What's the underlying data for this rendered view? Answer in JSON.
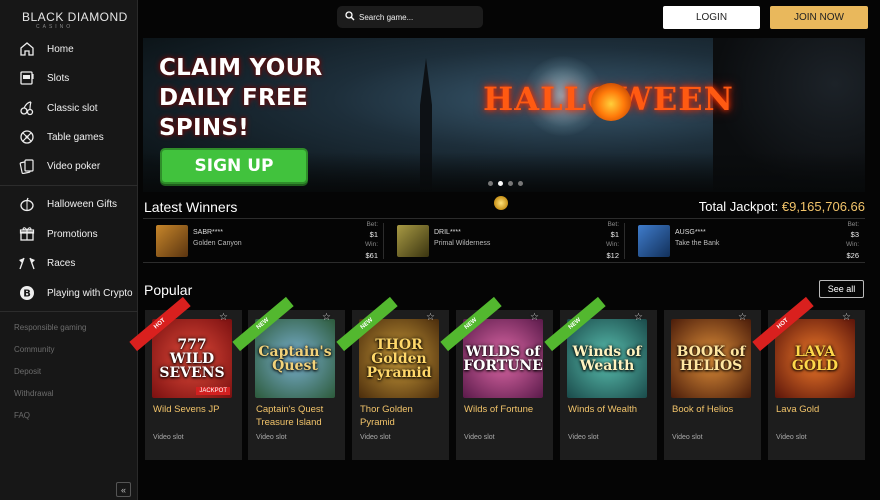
{
  "brand": {
    "logo": "BLACK DIAMOND",
    "logo_sub": "CASINO"
  },
  "search": {
    "placeholder": "Search game..."
  },
  "header": {
    "login": "LOGIN",
    "join": "JOIN NOW"
  },
  "sidebar": {
    "primary": [
      {
        "label": "Home",
        "icon": "home-icon"
      },
      {
        "label": "Slots",
        "icon": "slot-machine-icon"
      },
      {
        "label": "Classic slot",
        "icon": "cherry-icon"
      },
      {
        "label": "Table games",
        "icon": "roulette-icon"
      },
      {
        "label": "Video poker",
        "icon": "cards-icon"
      }
    ],
    "secondary": [
      {
        "label": "Halloween Gifts",
        "icon": "pumpkin-icon"
      },
      {
        "label": "Promotions",
        "icon": "gift-icon"
      },
      {
        "label": "Races",
        "icon": "race-flags-icon"
      },
      {
        "label": "Playing with Crypto",
        "icon": "bitcoin-icon"
      }
    ],
    "links": [
      "Responsible gaming",
      "Community",
      "Deposit",
      "Withdrawal",
      "FAQ"
    ],
    "collapse": "«"
  },
  "banner": {
    "headline": [
      "CLAIM YOUR",
      "DAILY FREE",
      "SPINS!"
    ],
    "cta": "SIGN UP",
    "art_text": "HALLOWEEN",
    "slides": 4,
    "active_slide": 2
  },
  "winners": {
    "title": "Latest Winners",
    "jackpot_label": "Total Jackpot:",
    "jackpot_value": "€9,165,706.66",
    "bet_label": "Bet:",
    "win_label": "Win:",
    "items": [
      {
        "user": "SABR****",
        "game": "Golden Canyon",
        "bet": "$1",
        "win": "$61",
        "color": "#8a5a1c"
      },
      {
        "user": "DRIL****",
        "game": "Primal Wilderness",
        "bet": "$1",
        "win": "$12",
        "color": "#7a6a24"
      },
      {
        "user": "AUSG****",
        "game": "Take the Bank",
        "bet": "$3",
        "win": "$26",
        "color": "#2a5a9a"
      }
    ]
  },
  "popular": {
    "title": "Popular",
    "see_all": "See all",
    "games": [
      {
        "name": "Wild Sevens JP",
        "type": "Video slot",
        "badge": "HOT",
        "art": "777 WILD SEVENS",
        "jackpot": "JACKPOT",
        "bg": "#b5231f"
      },
      {
        "name": "Captain's Quest Treasure Island",
        "type": "Video slot",
        "badge": "NEW",
        "art": "Captain's Quest",
        "bg": "#3d6a3a"
      },
      {
        "name": "Thor Golden Pyramid",
        "type": "Video slot",
        "badge": "NEW",
        "art": "THOR Golden Pyramid",
        "bg": "#6a4a18"
      },
      {
        "name": "Wilds of Fortune",
        "type": "Video slot",
        "badge": "NEW",
        "art": "WILDS of FORTUNE",
        "bg": "#b02a6a"
      },
      {
        "name": "Winds of Wealth",
        "type": "Video slot",
        "badge": "NEW",
        "art": "Winds of Wealth",
        "bg": "#1f6a6a"
      },
      {
        "name": "Book of Helios",
        "type": "Video slot",
        "badge": "",
        "art": "BOOK of HELIOS",
        "bg": "#7a3a14"
      },
      {
        "name": "Lava Gold",
        "type": "Video slot",
        "badge": "HOT",
        "art": "LAVA GOLD",
        "bg": "#a8320e"
      }
    ]
  }
}
